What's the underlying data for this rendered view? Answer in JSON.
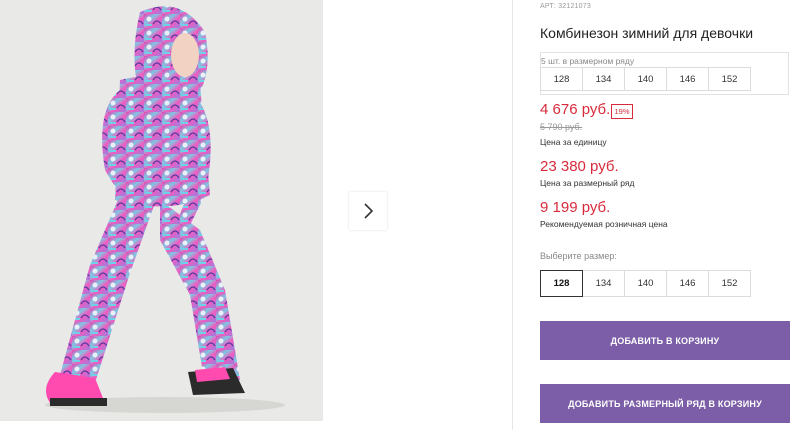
{
  "product": {
    "sku": "АРТ: 32121073",
    "title": "Комбинезон зимний для девочки"
  },
  "size_set": {
    "label": "5 шт. в размерном ряду",
    "sizes": [
      "128",
      "134",
      "140",
      "146",
      "152"
    ]
  },
  "prices": {
    "unit_price": "4 676 руб.",
    "discount_badge": "19%",
    "old_price": "5 790 руб.",
    "unit_caption": "Цена за единицу",
    "set_price": "23 380 руб.",
    "set_caption": "Цена за размерный ряд",
    "retail_price": "9 199 руб.",
    "retail_caption": "Рекомендуемая розничная цена"
  },
  "size_select": {
    "label": "Выберите размер:",
    "sizes": [
      "128",
      "134",
      "140",
      "146",
      "152"
    ],
    "selected": "128"
  },
  "actions": {
    "add_to_cart": "ДОБАВИТЬ В КОРЗИНУ",
    "add_set_to_cart": "ДОБАВИТЬ РАЗМЕРНЫЙ РЯД В КОРЗИНУ"
  },
  "icons": {
    "next": "chevron-right-icon"
  },
  "colors": {
    "accent": "#7b5ea7",
    "price": "#d72b3b"
  }
}
